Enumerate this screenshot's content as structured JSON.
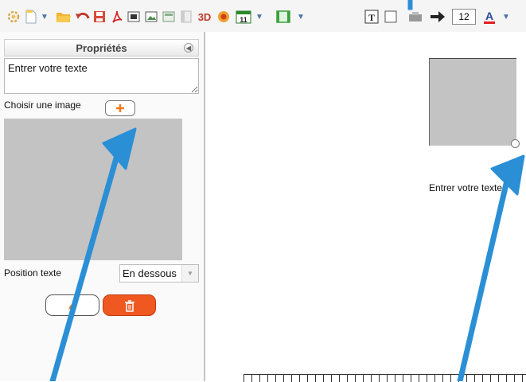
{
  "toolbar": {
    "items": [
      {
        "name": "settings-icon"
      },
      {
        "name": "new-document-icon"
      },
      {
        "name": "open-folder-icon"
      },
      {
        "name": "undo-icon"
      },
      {
        "name": "save-icon"
      },
      {
        "name": "pdf-icon"
      },
      {
        "name": "screenshot-icon"
      },
      {
        "name": "slide-icon"
      },
      {
        "name": "page-icon"
      },
      {
        "name": "3d-button"
      },
      {
        "name": "record-icon"
      },
      {
        "name": "calendar-icon"
      },
      {
        "name": "frame-icon"
      },
      {
        "name": "text-box-icon"
      },
      {
        "name": "rectangle-icon"
      },
      {
        "name": "stamp-icon"
      },
      {
        "name": "arrow-icon"
      },
      {
        "name": "text-color-icon"
      }
    ],
    "label_3d": "3D",
    "calendar_day": "11",
    "text_tool": "T",
    "font_size": "12",
    "font_color_letter": "A",
    "accent_color": "#e02020"
  },
  "panel": {
    "title": "Propriétés",
    "text_value": "Entrer votre texte",
    "choose_image_label": "Choisir une image",
    "position_label": "Position texte",
    "position_value": "En dessous",
    "position_options": [
      "En dessous"
    ]
  },
  "canvas": {
    "widget_caption": "Entrer votre texte"
  },
  "colors": {
    "arrow": "#2b8fd6",
    "delete_button": "#f05822",
    "add_icon": "#f07a1a"
  }
}
